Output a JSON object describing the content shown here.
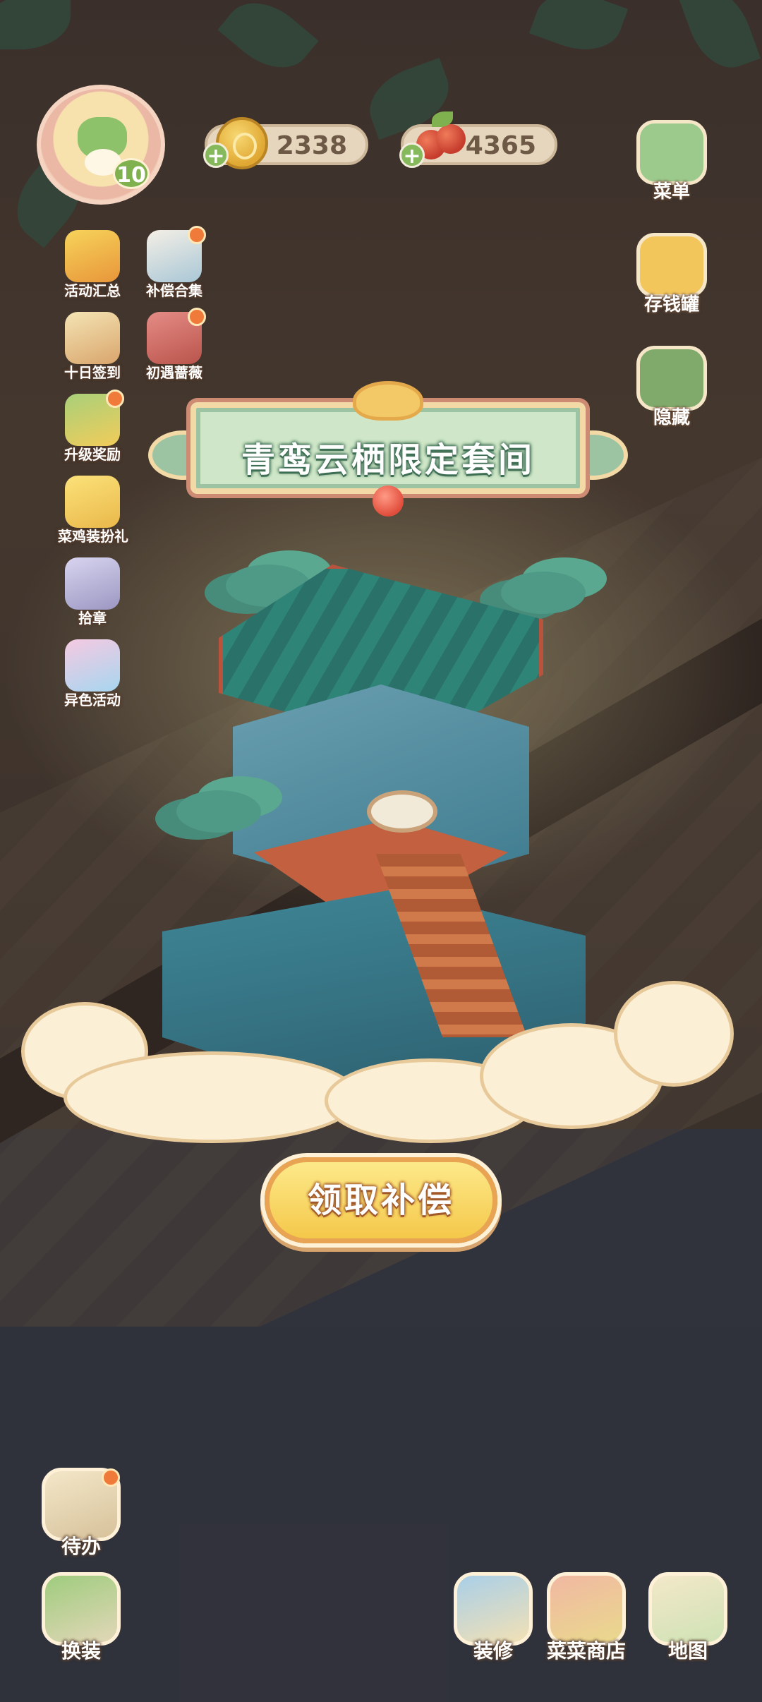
{
  "hud": {
    "level": "10",
    "coins": "2338",
    "berries": "4365",
    "plus_symbol": "+"
  },
  "activities": [
    {
      "label": "活动汇总",
      "icon": "event-summary-icon",
      "badge": false
    },
    {
      "label": "补偿合集",
      "icon": "compensation-collection-icon",
      "badge": true
    },
    {
      "label": "十日签到",
      "icon": "ten-day-checkin-icon",
      "badge": false
    },
    {
      "label": "初遇蔷薇",
      "icon": "rose-encounter-icon",
      "badge": true
    },
    {
      "label": "升级奖励",
      "icon": "upgrade-reward-icon",
      "badge": true
    },
    {
      "label": "菜鸡装扮礼",
      "icon": "chick-costume-gift-icon",
      "badge": false
    },
    {
      "label": "拾章",
      "icon": "collect-badge-icon",
      "badge": false
    },
    {
      "label": "异色活动",
      "icon": "color-variant-event-icon",
      "badge": false
    }
  ],
  "side_buttons": [
    {
      "label": "菜单",
      "icon": "menu-icon"
    },
    {
      "label": "存钱罐",
      "icon": "piggy-bank-icon"
    },
    {
      "label": "隐藏",
      "icon": "hide-ui-icon"
    }
  ],
  "popup": {
    "title": "青鸾云栖限定套间",
    "claim_label": "领取补偿"
  },
  "bottom_left": [
    {
      "label": "待办",
      "icon": "todo-icon"
    },
    {
      "label": "换装",
      "icon": "dress-up-icon"
    }
  ],
  "bottom_right": [
    {
      "label": "装修",
      "icon": "decorate-icon"
    },
    {
      "label": "菜菜商店",
      "icon": "shop-icon"
    },
    {
      "label": "地图",
      "icon": "map-icon"
    }
  ],
  "colors": {
    "accent_green": "#7fb24f",
    "button_yellow": "#f4c84a",
    "badge_orange": "#f07a3a",
    "title_green": "#3f6f55"
  }
}
